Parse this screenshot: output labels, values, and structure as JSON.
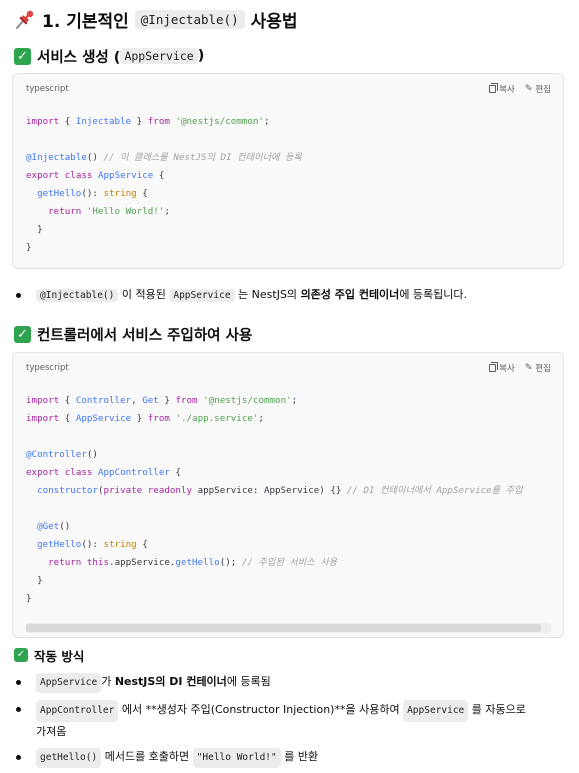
{
  "heading": {
    "prefix": "1. 기본적인",
    "code": "@Injectable()",
    "suffix": "사용법",
    "icon": "pushpin-icon"
  },
  "section1": {
    "title": "서비스 생성 (",
    "code": "AppService",
    "close": ")",
    "icon": "check-mark-icon"
  },
  "codeblock1": {
    "language": "typescript",
    "copy_label": "복사",
    "edit_label": "편집"
  },
  "bullet1": {
    "code1": "@Injectable()",
    "t1": "이 적용된",
    "code2": "AppService",
    "t2": "는 NestJS의",
    "bold": "의존성 주입 컨테이너",
    "t3": "에 등록됩니다."
  },
  "section2": {
    "title": "컨트롤러에서 서비스 주입하여 사용",
    "icon": "check-mark-icon"
  },
  "codeblock2": {
    "language": "typescript",
    "copy_label": "복사",
    "edit_label": "편집"
  },
  "section3": {
    "title": "작동 방식",
    "icon": "check-mark-icon"
  },
  "bullets2": {
    "b1_code": "AppService",
    "b1_t1": "가",
    "b1_bold": "NestJS의 DI 컨테이너",
    "b1_t2": "에 등록됨",
    "b2_code1": "AppController",
    "b2_t1": "에서 **생성자 주입(Constructor Injection)**을 사용하여",
    "b2_code2": "AppService",
    "b2_t2": "를 자동으로",
    "b2_t3": "가져옴",
    "b3_code1": "getHello()",
    "b3_t1": "메서드를 호출하면",
    "b3_code2": "\"Hello World!\"",
    "b3_t2": "를 반환"
  },
  "colors": {
    "check_green": "#2ea44f",
    "code_bg": "#f9f9f9",
    "inline_code_bg": "#ececec"
  }
}
